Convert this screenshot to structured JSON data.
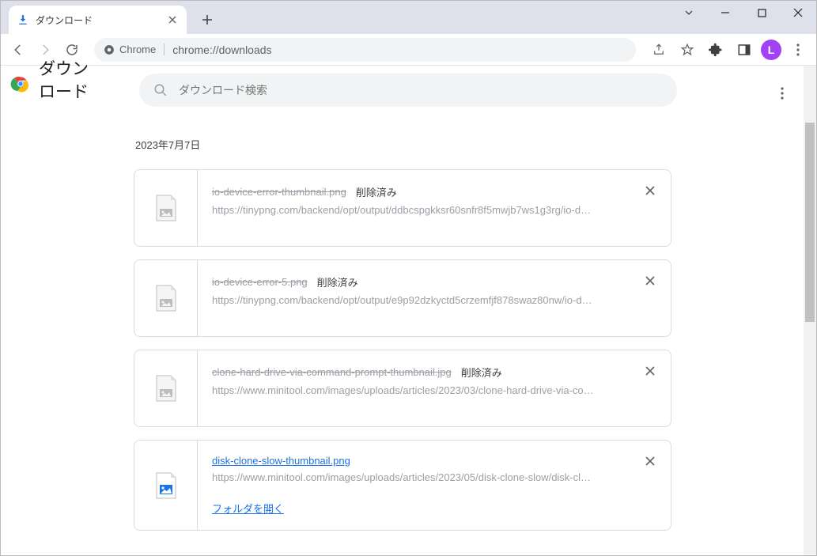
{
  "tab": {
    "title": "ダウンロード"
  },
  "address": {
    "chip_label": "Chrome",
    "url": "chrome://downloads"
  },
  "avatar_letter": "L",
  "page": {
    "title": "ダウンロード",
    "search_placeholder": "ダウンロード検索"
  },
  "date_heading": "2023年7月7日",
  "status_deleted": "削除済み",
  "folder_open_label": "フォルダを開く",
  "items": [
    {
      "filename": "io-device-error-thumbnail.png",
      "deleted": true,
      "url": "https://tinypng.com/backend/opt/output/ddbcspgkksr60snfr8f5mwjb7ws1g3rg/io-d…"
    },
    {
      "filename": "io-device-error-5.png",
      "deleted": true,
      "url": "https://tinypng.com/backend/opt/output/e9p92dzkyctd5crzemfjf878swaz80nw/io-d…"
    },
    {
      "filename": "clone-hard-drive-via-command-prompt-thumbnail.jpg",
      "deleted": true,
      "url": "https://www.minitool.com/images/uploads/articles/2023/03/clone-hard-drive-via-co…"
    },
    {
      "filename": "disk-clone-slow-thumbnail.png",
      "deleted": false,
      "url": "https://www.minitool.com/images/uploads/articles/2023/05/disk-clone-slow/disk-cl…"
    }
  ]
}
